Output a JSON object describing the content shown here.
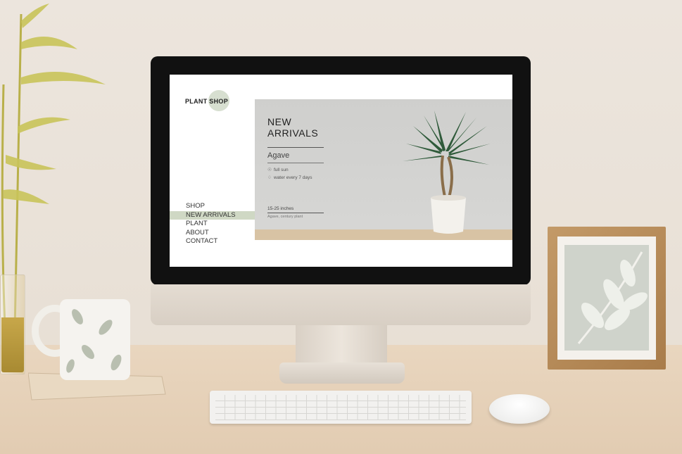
{
  "site": {
    "logo_text": "PLANT SHOP"
  },
  "nav": {
    "items": [
      {
        "label": "SHOP"
      },
      {
        "label": "NEW ARRIVALS"
      },
      {
        "label": "PLANT"
      },
      {
        "label": "ABOUT"
      },
      {
        "label": "CONTACT"
      }
    ],
    "active_index": 1
  },
  "hero": {
    "title_line1": "NEW",
    "title_line2": "ARRIVALS",
    "product_name": "Agave",
    "spec_sun": "full sun",
    "spec_water": "water every 7 days",
    "size": "15-25 inches",
    "caption": "Agave, century plant"
  },
  "icons": {
    "sun": "sun-icon",
    "water": "water-drop-icon"
  },
  "colors": {
    "accent": "#cfd8c4",
    "hero_bg": "#d2d2d0",
    "text": "#222222"
  }
}
